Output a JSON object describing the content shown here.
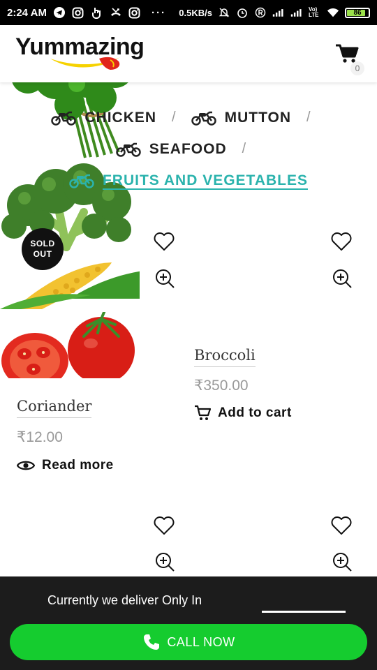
{
  "status_bar": {
    "time": "2:24 AM",
    "dots": "···",
    "net_speed": "0.5KB/s",
    "volte": "Vo) LTE",
    "battery": "86"
  },
  "header": {
    "logo_text": "Yummazing",
    "cart_count": "0"
  },
  "categories": [
    {
      "label": "CHICKEN",
      "active": false
    },
    {
      "label": "MUTTON",
      "active": false
    },
    {
      "label": "SEAFOOD",
      "active": false
    },
    {
      "label": "FRUITS AND VEGETABLES",
      "active": true
    }
  ],
  "separator": "/",
  "products": [
    {
      "name": "Coriander",
      "price": "₹12.00",
      "action": "Read more",
      "badge": [
        "SOLD",
        "OUT"
      ]
    },
    {
      "name": "Broccoli",
      "price": "₹350.00",
      "action": "Add to cart"
    }
  ],
  "bottom_bar": {
    "deliver_text": "Currently we deliver Only In",
    "call_label": "CALL NOW"
  },
  "colors": {
    "accent": "#2bb3ad",
    "call_green": "#15cc2f",
    "bottom_bar_bg": "#1c1c1c",
    "logo_red": "#e1251b",
    "logo_yellow": "#f6d200"
  },
  "icons": [
    "telegram-icon",
    "instagram-icon",
    "hand-icon",
    "missed-call-icon",
    "signal-icon",
    "wifi-icon",
    "battery-icon",
    "cart-icon",
    "bike-icon",
    "heart-icon",
    "zoom-in-icon",
    "eye-icon",
    "phone-icon"
  ]
}
